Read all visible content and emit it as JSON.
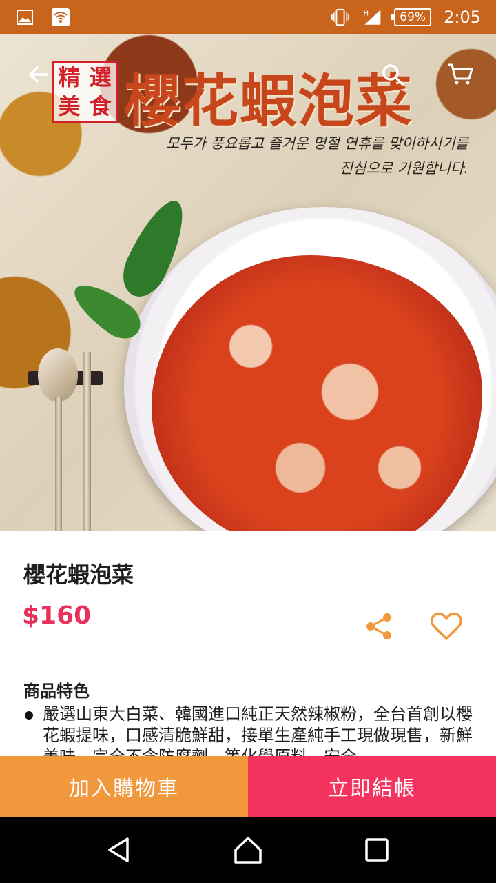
{
  "status_bar": {
    "battery": "69%",
    "time": "2:05",
    "network": "H"
  },
  "hero": {
    "stamp_chars": [
      "精",
      "選",
      "美",
      "食"
    ],
    "title": "櫻花蝦泡菜",
    "subtitle_line1": "모두가 풍요롭고 즐거운 명절 연휴를 맞이하시기를",
    "subtitle_line2": "진심으로 기원합니다."
  },
  "product": {
    "name": "櫻花蝦泡菜",
    "price": "$160"
  },
  "features": {
    "heading": "商品特色",
    "items": [
      "嚴選山東大白菜、韓國進口純正天然辣椒粉，全台首創以櫻花蝦提味，口感清脆鮮甜，接單生產純手工現做現售，新鮮美味，完全不含防腐劑、等化學原料，安全"
    ]
  },
  "actions": {
    "add_to_cart": "加入購物車",
    "checkout": "立即結帳"
  },
  "colors": {
    "status_bar": "#c9641c",
    "price": "#e8305a",
    "icon_accent": "#f1983c",
    "cart_button": "#f1983c",
    "checkout_button": "#f4335e"
  },
  "icons": {
    "back": "back-arrow-icon",
    "search": "search-icon",
    "cart": "cart-icon",
    "share": "share-icon",
    "favorite": "heart-icon"
  }
}
